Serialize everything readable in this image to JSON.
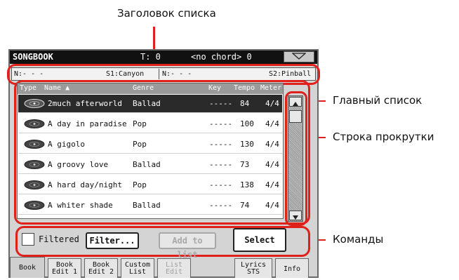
{
  "callouts": {
    "list_header": "Заголовок списка",
    "main_list": "Главный список",
    "scroll_bar": "Строка прокрутки",
    "commands": "Команды"
  },
  "titlebar": {
    "title": "SONGBOOK",
    "tempo_label": "T: 0",
    "chord": "<no chord> 0"
  },
  "header": {
    "n1": "N:- - -",
    "s1": "S1:Canyon",
    "n2": "N:- - -",
    "s2": "S2:Pinball"
  },
  "columns": {
    "type": "Type",
    "name": "Name ▲",
    "genre": "Genre",
    "key": "Key",
    "tempo": "Tempo",
    "meter": "Meter"
  },
  "rows": [
    {
      "name": "2much afterworld",
      "genre": "Ballad",
      "key": "-----",
      "tempo": "84",
      "meter": "4/4",
      "selected": true
    },
    {
      "name": "A day in paradise",
      "genre": "Pop",
      "key": "-----",
      "tempo": "100",
      "meter": "4/4"
    },
    {
      "name": "A gigolo",
      "genre": "Pop",
      "key": "-----",
      "tempo": "130",
      "meter": "4/4"
    },
    {
      "name": "A groovy love",
      "genre": "Ballad",
      "key": "-----",
      "tempo": "73",
      "meter": "4/4"
    },
    {
      "name": "A hard day/night",
      "genre": "Pop",
      "key": "-----",
      "tempo": "138",
      "meter": "4/4"
    },
    {
      "name": "A whiter shade",
      "genre": "Ballad",
      "key": "-----",
      "tempo": "74",
      "meter": "4/4"
    }
  ],
  "commands": {
    "filtered": "Filtered",
    "filter": "Filter...",
    "add_to_list": "Add to list",
    "select": "Select"
  },
  "tabs": {
    "book": "Book",
    "book_edit1_a": "Book",
    "book_edit1_b": "Edit 1",
    "book_edit2_a": "Book",
    "book_edit2_b": "Edit 2",
    "custom_list_a": "Custom",
    "custom_list_b": "List",
    "list_edit_a": "List",
    "list_edit_b": "Edit",
    "lyrics_a": "Lyrics",
    "lyrics_b": "STS",
    "info": "Info"
  },
  "colors": {
    "callout_red": "#e0201b",
    "selected_row": "#2a2a2a"
  }
}
